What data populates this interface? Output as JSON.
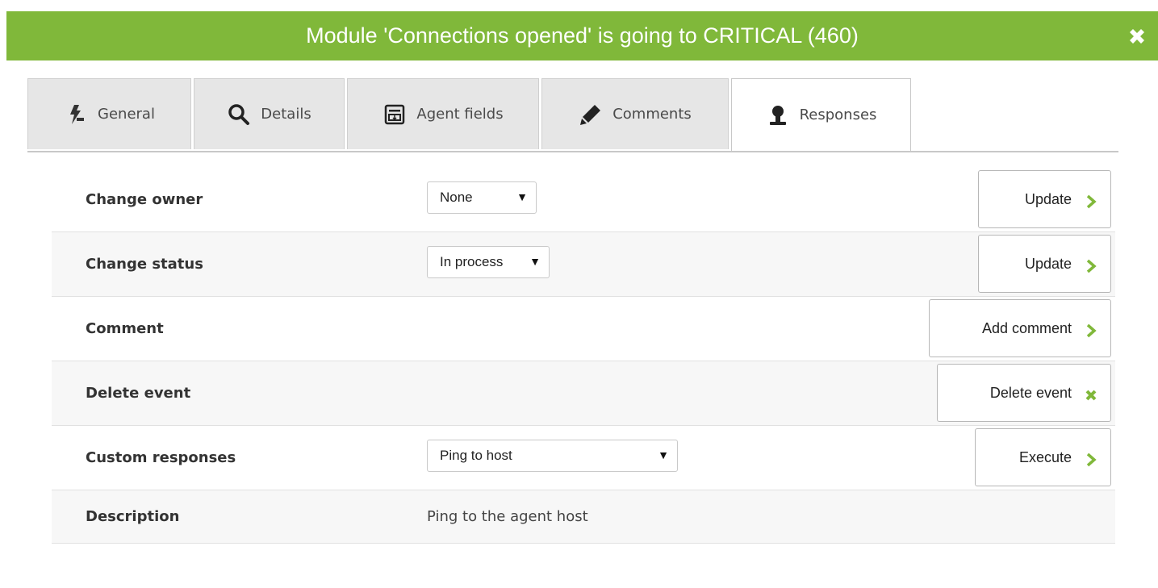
{
  "dialog": {
    "title": "Module 'Connections opened' is going to CRITICAL (460)",
    "close_icon": "close-icon",
    "accent_color": "#80b83a"
  },
  "tabs": [
    {
      "label": "General",
      "icon": "general-icon",
      "active": false
    },
    {
      "label": "Details",
      "icon": "magnifier-icon",
      "active": false
    },
    {
      "label": "Agent fields",
      "icon": "agent-fields-icon",
      "active": false
    },
    {
      "label": "Comments",
      "icon": "pencil-icon",
      "active": false
    },
    {
      "label": "Responses",
      "icon": "user-icon",
      "active": true
    }
  ],
  "responses": {
    "change_owner": {
      "label": "Change owner",
      "select_value": "None",
      "button_label": "Update"
    },
    "change_status": {
      "label": "Change status",
      "select_value": "In process",
      "button_label": "Update"
    },
    "comment": {
      "label": "Comment",
      "button_label": "Add comment"
    },
    "delete_event": {
      "label": "Delete event",
      "button_label": "Delete event"
    },
    "custom_responses": {
      "label": "Custom responses",
      "select_value": "Ping to host",
      "button_label": "Execute"
    },
    "description": {
      "label": "Description",
      "value": "Ping to the agent host"
    }
  }
}
